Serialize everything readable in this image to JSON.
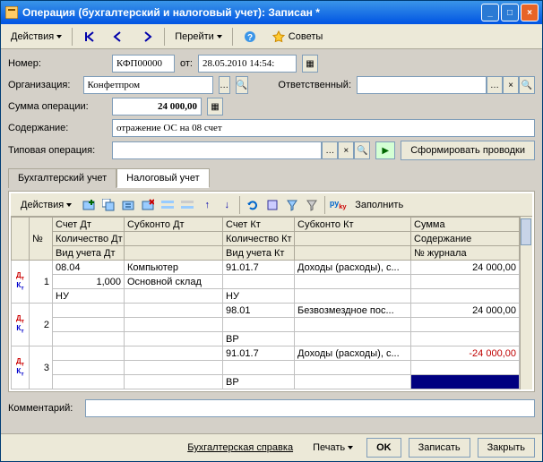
{
  "title": "Операция (бухгалтерский и налоговый учет):  Записан *",
  "toolbar": {
    "actions": "Действия",
    "goto": "Перейти",
    "advice": "Советы"
  },
  "form": {
    "number_label": "Номер:",
    "number_value": "КФП00000",
    "from_label": "от:",
    "date_value": "28.05.2010 14:54:",
    "org_label": "Организация:",
    "org_value": "Конфетпром",
    "resp_label": "Ответственный:",
    "resp_value": "",
    "sum_label": "Сумма операции:",
    "sum_value": "24 000,00",
    "content_label": "Содержание:",
    "content_value": "отражение ОС на 08 счет",
    "typeop_label": "Типовая операция:",
    "typeop_value": "",
    "generate_btn": "Сформировать проводки"
  },
  "tabs": {
    "tab1": "Бухгалтерский учет",
    "tab2": "Налоговый учет"
  },
  "grid_toolbar": {
    "actions": "Действия",
    "fill": "Заполнить"
  },
  "headers": {
    "n": "№",
    "sdt": "Счет Дт",
    "subdt": "Субконто Дт",
    "skt": "Счет Кт",
    "subkt": "Субконто Кт",
    "sum": "Сумма",
    "qdt": "Количество Дт",
    "qkt": "Количество Кт",
    "content": "Содержание",
    "vdt": "Вид учета Дт",
    "vkt": "Вид учета Кт",
    "journ": "№ журнала"
  },
  "rows": [
    {
      "n": "1",
      "sdt": "08.04",
      "subdt1": "Компьютер",
      "qdt": "1,000",
      "subdt2": "Основной склад",
      "vdt": "НУ",
      "skt": "91.01.7",
      "vkt": "НУ",
      "subkt": "Доходы (расходы), с...",
      "sum": "24 000,00",
      "neg": false
    },
    {
      "n": "2",
      "sdt": "",
      "subdt1": "",
      "qdt": "",
      "subdt2": "",
      "vdt": "",
      "skt": "98.01",
      "vkt": "ВР",
      "subkt": "Безвозмездное пос...",
      "sum": "24 000,00",
      "neg": false
    },
    {
      "n": "3",
      "sdt": "",
      "subdt1": "",
      "qdt": "",
      "subdt2": "",
      "vdt": "",
      "skt": "91.01.7",
      "vkt": "ВР",
      "subkt": "Доходы (расходы), с...",
      "sum": "-24 000,00",
      "neg": true
    }
  ],
  "comment_label": "Комментарий:",
  "comment_value": "",
  "bottom": {
    "spravka": "Бухгалтерская справка",
    "print": "Печать",
    "ok": "OK",
    "save": "Записать",
    "close": "Закрыть"
  }
}
